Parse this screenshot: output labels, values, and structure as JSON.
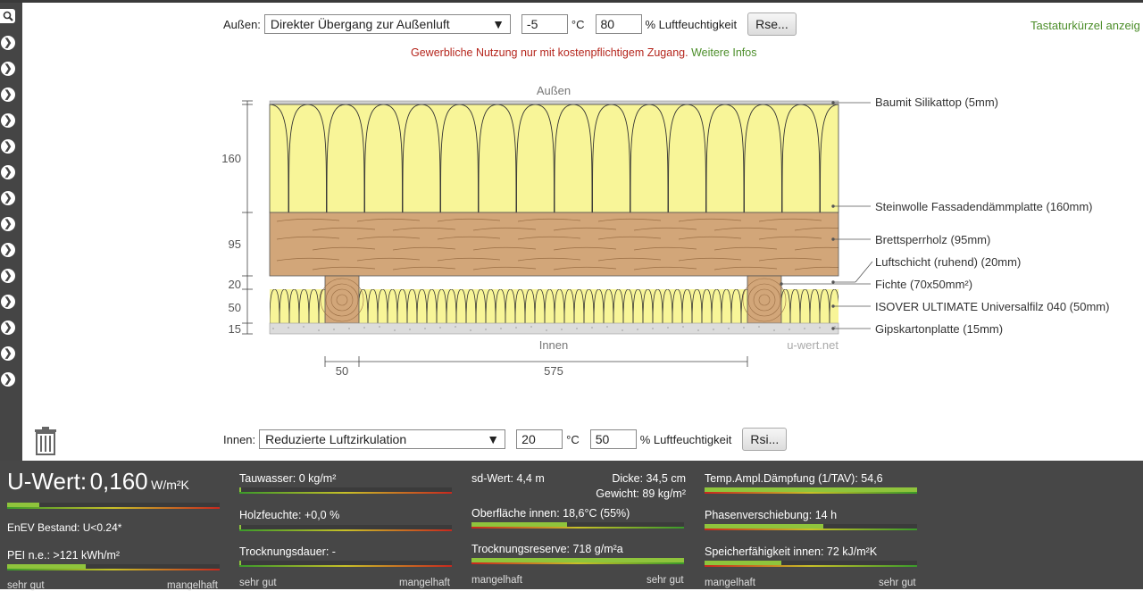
{
  "outside": {
    "label": "Außen:",
    "select_value": "Direkter Übergang zur Außenluft",
    "temperature": "-5",
    "temp_unit": "°C",
    "humidity": "80",
    "humidity_unit": "% Luftfeuchtigkeit",
    "button_label": "Rse..."
  },
  "inside": {
    "label": "Innen:",
    "select_value": "Reduzierte Luftzirkulation",
    "temperature": "20",
    "temp_unit": "°C",
    "humidity": "50",
    "humidity_unit": "% Luftfeuchtigkeit",
    "button_label": "Rsi..."
  },
  "shortcuts_link": "Tastaturkürzel anzeig",
  "notice": {
    "text": "Gewerbliche Nutzung nur mit kostenpflichtigem Zugang.",
    "link": "Weitere Infos"
  },
  "diagram": {
    "top_label": "Außen",
    "bottom_label": "Innen",
    "watermark": "u-wert.net",
    "dimensions": [
      "160",
      "95",
      "20",
      "50",
      "15"
    ],
    "bottom_dimensions": [
      "50",
      "575"
    ],
    "layers": [
      "Baumit Silikattop (5mm)",
      "Steinwolle Fassadendämmplatte (160mm)",
      "Brettsperrholz (95mm)",
      "Luftschicht (ruhend) (20mm)",
      "Fichte (70x50mm²)",
      "ISOVER ULTIMATE Universalfilz 040 (50mm)",
      "Gipskartonplatte (15mm)"
    ],
    "colors": {
      "insulation": "#f8f598",
      "wood": "#d2a679",
      "plaster": "#dcdcdc",
      "render": "#cfcfcf"
    }
  },
  "footer": {
    "u_label": "U-Wert:",
    "u_value": "0,160",
    "u_unit": "W/m²K",
    "u_bar": 0.15,
    "enev": "EnEV Bestand: U<0.24*",
    "pei": "PEI n.e.: >121 kWh/m²",
    "pei_bar": 0.37,
    "tauwasser": "Tauwasser: 0 kg/m²",
    "tauwasser_bar": 0.01,
    "holzfeuchte": "Holzfeuchte: +0,0 %",
    "holzfeuchte_bar": 0.01,
    "trocknungsdauer": "Trocknungsdauer: -",
    "trocknungsdauer_bar": 0.01,
    "sd_wert": "sd-Wert: 4,4 m",
    "dicke": "Dicke: 34,5 cm",
    "gewicht": "Gewicht: 89 kg/m²",
    "oberflaeche": "Oberfläche innen: 18,6°C (55%)",
    "oberflaeche_bar": 0.45,
    "trocknungsreserve": "Trocknungsreserve: 718 g/m²a",
    "trocknungsreserve_bar": 1.0,
    "tav": "Temp.Ampl.Dämpfung (1/TAV): 54,6",
    "tav_bar": 1.0,
    "phase": "Phasenverschiebung: 14 h",
    "phase_bar": 0.56,
    "speicher": "Speicherfähigkeit innen: 72 kJ/m²K",
    "speicher_bar": 0.36,
    "scale_good": "sehr gut",
    "scale_bad": "mangelhaft"
  }
}
